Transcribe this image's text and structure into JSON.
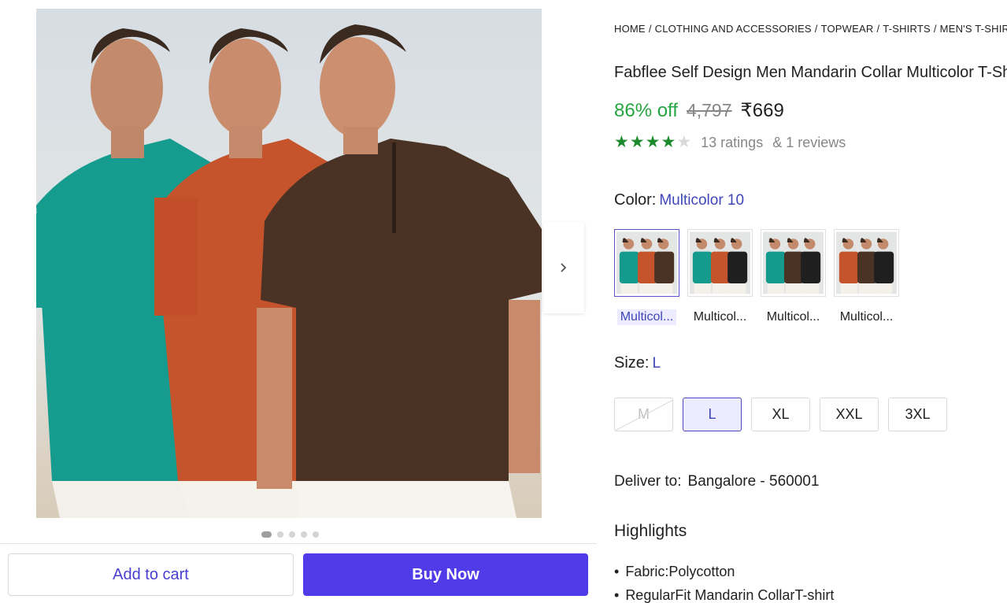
{
  "breadcrumb": [
    "HOME",
    "CLOTHING AND ACCESSORIES",
    "TOPWEAR",
    "T-SHIRTS",
    "MEN'S T-SHIRTS"
  ],
  "product": {
    "title": "Fabflee Self Design Men Mandarin Collar Multicolor T-Shirt",
    "discount": "86% off",
    "mrp": "4,797",
    "price": "₹669",
    "rating_value": 4,
    "rating_max": 5,
    "ratings_text": "13 ratings",
    "reviews_text": "& 1 reviews"
  },
  "color": {
    "label": "Color:",
    "selected": "Multicolor 10",
    "options": [
      {
        "label": "Multicol...",
        "shirts": [
          "#149b8e",
          "#c5532c",
          "#4a3225"
        ]
      },
      {
        "label": "Multicol...",
        "shirts": [
          "#149b8e",
          "#c5532c",
          "#1f1f1f"
        ]
      },
      {
        "label": "Multicol...",
        "shirts": [
          "#149b8e",
          "#4a3225",
          "#1f1f1f"
        ]
      },
      {
        "label": "Multicol...",
        "shirts": [
          "#c5532c",
          "#4a3225",
          "#1f1f1f"
        ]
      }
    ]
  },
  "size": {
    "label": "Size:",
    "selected": "L",
    "options": [
      {
        "label": "M",
        "available": false
      },
      {
        "label": "L",
        "available": true
      },
      {
        "label": "XL",
        "available": true
      },
      {
        "label": "XXL",
        "available": true
      },
      {
        "label": "3XL",
        "available": true
      }
    ]
  },
  "delivery": {
    "label": "Deliver to:",
    "location": "Bangalore - 560001"
  },
  "highlights": {
    "title": "Highlights",
    "items": [
      "Fabric:Polycotton",
      "RegularFit Mandarin CollarT-shirt"
    ]
  },
  "gallery": {
    "image_count": 5,
    "current_index": 0
  },
  "actions": {
    "add_to_cart": "Add to cart",
    "buy_now": "Buy Now"
  },
  "colors": {
    "accent": "#4f3ce8",
    "discount": "#26a541",
    "star": "#1c8a2c",
    "selected_text": "#3e46b8"
  }
}
